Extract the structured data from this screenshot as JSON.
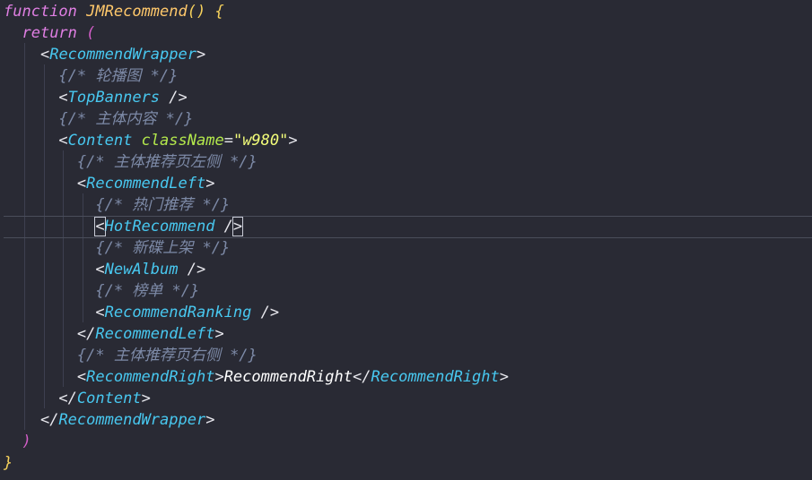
{
  "code": {
    "line1": {
      "keyword": "function",
      "name": "JMRecommend",
      "parens": "()",
      "brace": "{"
    },
    "line2": {
      "keyword": "return",
      "paren": "("
    },
    "line3": {
      "open": "<",
      "tag": "RecommendWrapper",
      "close": ">"
    },
    "line4": {
      "comment": "{/* 轮播图 */}"
    },
    "line5": {
      "open": "<",
      "tag": "TopBanners",
      "close": " />"
    },
    "line6": {
      "comment": "{/* 主体内容 */}"
    },
    "line7": {
      "open": "<",
      "tag": "Content",
      "attr": "className",
      "eq": "=",
      "value": "\"w980\"",
      "close": ">"
    },
    "line8": {
      "comment": "{/* 主体推荐页左侧 */}"
    },
    "line9": {
      "open": "<",
      "tag": "RecommendLeft",
      "close": ">"
    },
    "line10": {
      "comment": "{/* 热门推荐 */}"
    },
    "line11": {
      "open": "<",
      "tag": "HotRecommend",
      "slash": " /",
      "close": ">"
    },
    "line12": {
      "comment": "{/* 新碟上架 */}"
    },
    "line13": {
      "open": "<",
      "tag": "NewAlbum",
      "close": " />"
    },
    "line14": {
      "comment": "{/* 榜单 */}"
    },
    "line15": {
      "open": "<",
      "tag": "RecommendRanking",
      "close": " />"
    },
    "line16": {
      "open": "</",
      "tag": "RecommendLeft",
      "close": ">"
    },
    "line17": {
      "comment": "{/* 主体推荐页右侧 */}"
    },
    "line18": {
      "open": "<",
      "tag": "RecommendRight",
      "mid1": ">",
      "text": "RecommendRight",
      "mid2": "</",
      "tag2": "RecommendRight",
      "close": ">"
    },
    "line19": {
      "open": "</",
      "tag": "Content",
      "close": ">"
    },
    "line20": {
      "open": "</",
      "tag": "RecommendWrapper",
      "close": ">"
    },
    "line21": {
      "paren": ")"
    },
    "line22": {
      "brace": "}"
    }
  }
}
